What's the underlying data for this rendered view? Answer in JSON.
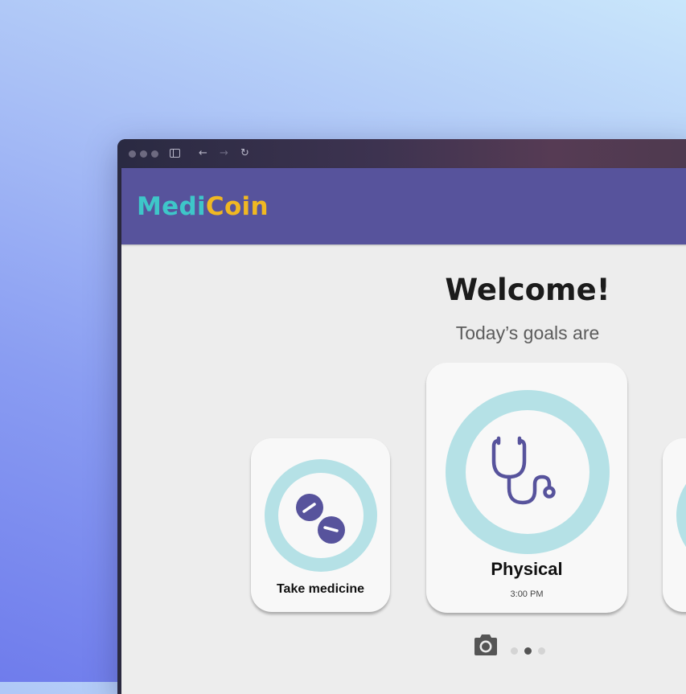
{
  "browser": {
    "back_icon": "←",
    "forward_icon": "→",
    "reload_icon": "↻"
  },
  "app": {
    "logo_part1": "Medi",
    "logo_part2": "Coin"
  },
  "welcome": {
    "title": "Welcome!",
    "subtitle": "Today’s goals are"
  },
  "goals": [
    {
      "label": "Take medicine",
      "icon": "pills-icon"
    },
    {
      "label": "Physical",
      "time": "3:00 PM",
      "icon": "stethoscope-icon"
    },
    {
      "label": "",
      "icon": "goal-icon"
    }
  ],
  "pager": {
    "camera_icon": "camera-icon",
    "page_count": 3,
    "active_page": 2
  },
  "colors": {
    "header": "#57539c",
    "logo_medi": "#3ec6c9",
    "logo_coin": "#f0b822",
    "ring": "#b5e1e6",
    "icon": "#57539c"
  }
}
